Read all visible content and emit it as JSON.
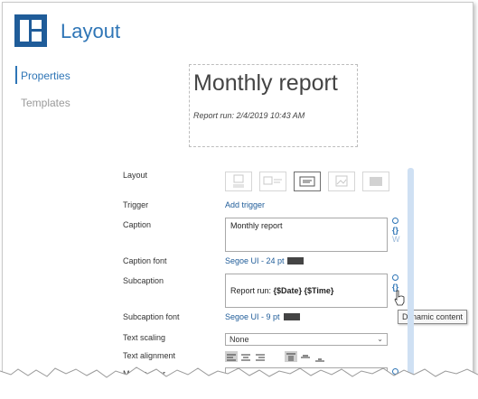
{
  "header": {
    "title": "Layout",
    "icon": "layout-app-icon"
  },
  "nav": {
    "items": [
      {
        "label": "Properties",
        "active": true
      },
      {
        "label": "Templates",
        "active": false
      }
    ]
  },
  "preview": {
    "title": "Monthly report",
    "subtitle": "Report run: 2/4/2019 10:43 AM"
  },
  "form": {
    "layout": {
      "label": "Layout",
      "selected_index": 2,
      "options": 5
    },
    "trigger": {
      "label": "Trigger",
      "link": "Add trigger"
    },
    "caption": {
      "label": "Caption",
      "value": "Monthly report"
    },
    "caption_font": {
      "label": "Caption font",
      "value": "Segoe UI - 24 pt",
      "color": "#444444"
    },
    "subcaption": {
      "label": "Subcaption",
      "value_prefix": "Report run: ",
      "value_tokens": "{$Date} {$Time}"
    },
    "subcaption_font": {
      "label": "Subcaption font",
      "value": "Segoe UI - 9 pt",
      "color": "#444444"
    },
    "text_scaling": {
      "label": "Text scaling",
      "value": "None"
    },
    "text_alignment": {
      "label": "Text alignment"
    },
    "mouse_over": {
      "label": "Mouse over"
    }
  },
  "side_icons": {
    "braces": "{}",
    "w": "W"
  },
  "tooltip": {
    "text": "Dynamic content"
  },
  "colors": {
    "accent": "#2e75b6",
    "icon_bg": "#1f5c99",
    "scrollbar": "#cfe0f3"
  }
}
